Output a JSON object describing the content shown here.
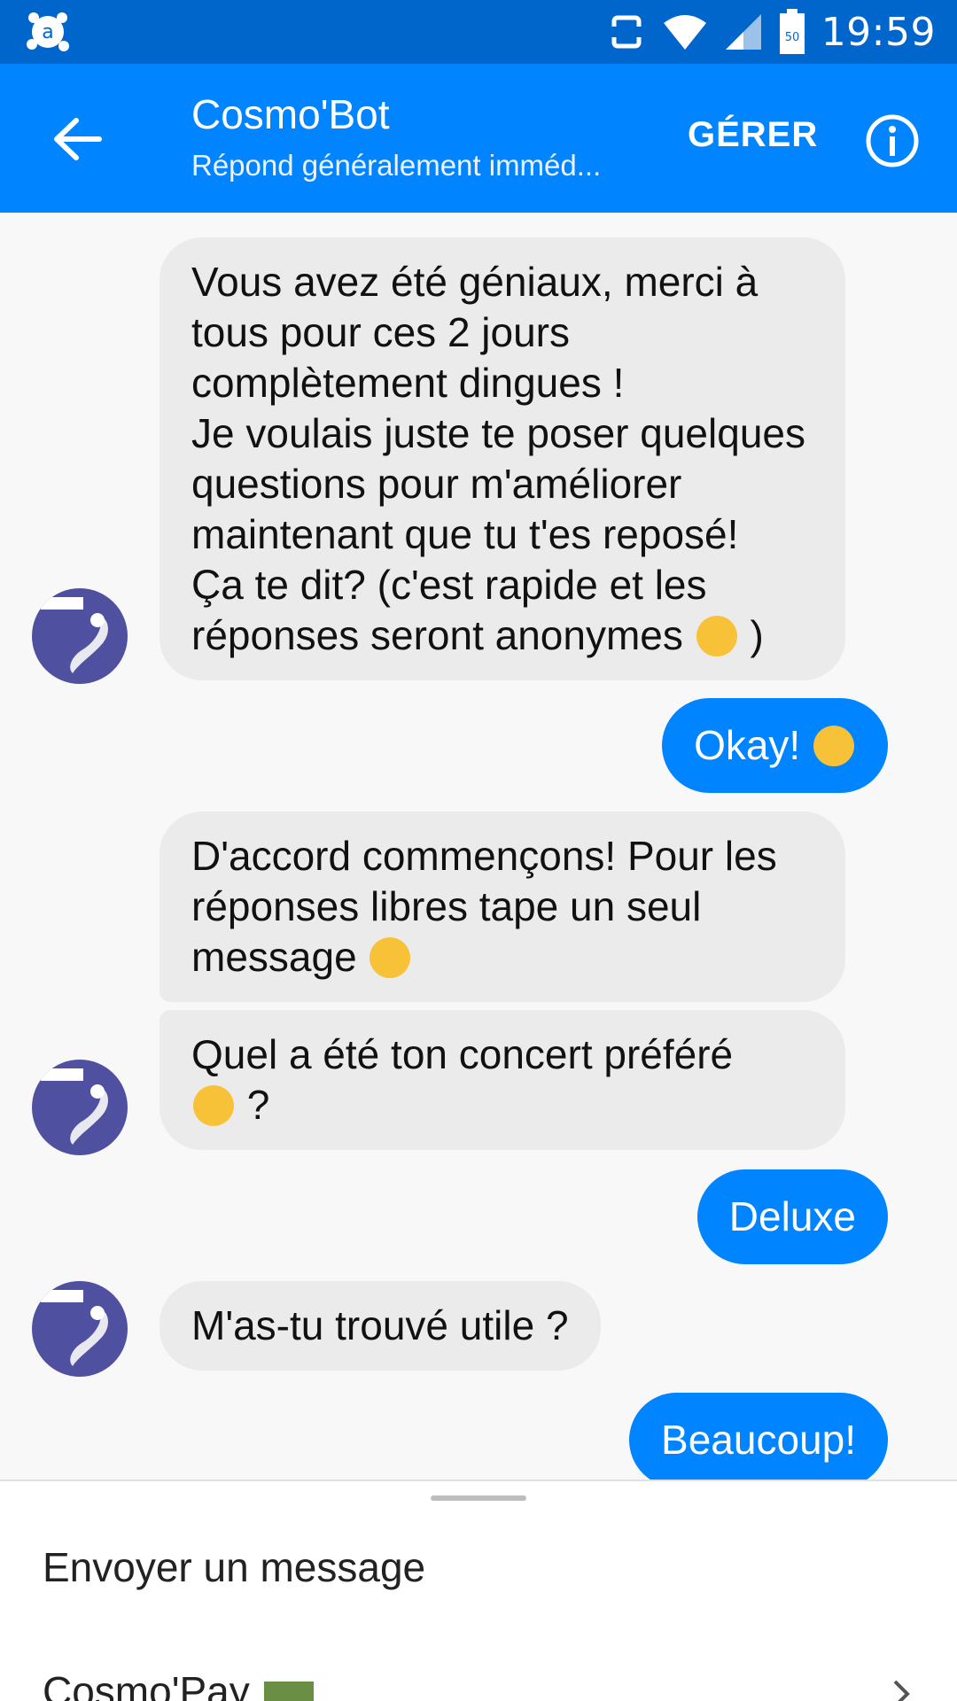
{
  "status_bar": {
    "time": "19:59",
    "battery_level": "50"
  },
  "header": {
    "title": "Cosmo'Bot",
    "subtitle": "Répond généralement imméd...",
    "manage_label": "GÉRER"
  },
  "messages": [
    {
      "from": "bot",
      "lines": [
        "Vous avez été géniaux, merci à",
        "tous pour ces 2 jours",
        "complètement dingues !",
        "Je voulais juste te poser quelques",
        "questions pour m'améliorer",
        "maintenant que tu t'es reposé!",
        "Ça te dit? (c'est rapide et les",
        "réponses seront anonymes"
      ],
      "tail": ")"
    },
    {
      "from": "user",
      "text": "Okay!"
    },
    {
      "from": "bot",
      "lines": [
        "D'accord commençons! Pour les",
        "réponses libres tape un seul",
        "message"
      ]
    },
    {
      "from": "bot",
      "lines": [
        "Quel a été ton concert préféré"
      ],
      "tail": "?"
    },
    {
      "from": "user",
      "text": "Deluxe"
    },
    {
      "from": "bot",
      "lines": [
        "M'as-tu trouvé utile ?"
      ]
    },
    {
      "from": "user",
      "text": "Beaucoup!"
    }
  ],
  "composer": {
    "placeholder": "Envoyer un message",
    "menu_item": "Cosmo'Pay"
  },
  "colors": {
    "status_bar": "#0066cc",
    "app_bar": "#0084ff",
    "bubble_user": "#0084ff",
    "bubble_bot": "#ebebeb"
  }
}
